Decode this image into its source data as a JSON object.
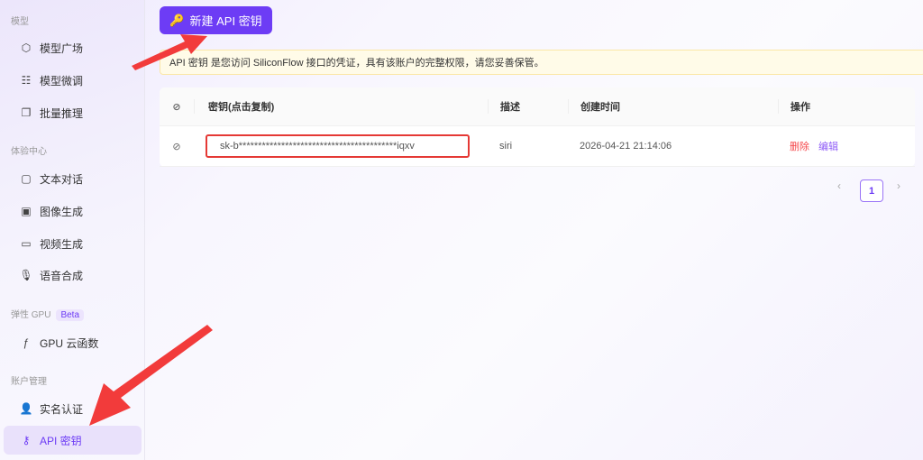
{
  "sidebar": {
    "sections": [
      "模型",
      "体验中心",
      "弹性 GPU",
      "账户管理"
    ],
    "beta": "Beta",
    "items": [
      {
        "label": "模型广场",
        "icon": "cube-icon"
      },
      {
        "label": "模型微调",
        "icon": "sliders-icon"
      },
      {
        "label": "批量推理",
        "icon": "layers-icon"
      },
      {
        "label": "文本对话",
        "icon": "chat-icon"
      },
      {
        "label": "图像生成",
        "icon": "image-icon"
      },
      {
        "label": "视频生成",
        "icon": "video-icon"
      },
      {
        "label": "语音合成",
        "icon": "mic-icon"
      },
      {
        "label": "GPU 云函数",
        "icon": "function-icon"
      },
      {
        "label": "实名认证",
        "icon": "user-check-icon"
      },
      {
        "label": "API 密钥",
        "icon": "key-icon"
      }
    ]
  },
  "main": {
    "new_button": "新建 API 密钥",
    "notice": "API 密钥 是您访问 SiliconFlow 接口的凭证，具有该账户的完整权限，请您妥善保管。",
    "table": {
      "headers": [
        "密钥(点击复制)",
        "描述",
        "创建时间",
        "操作"
      ],
      "rows": [
        {
          "key": "sk-b*****************************************iqxv",
          "desc": "siri",
          "created": "2026-04-21 21:14:06",
          "delete": "删除",
          "edit": "编辑"
        }
      ]
    },
    "pagination": {
      "current": "1"
    }
  },
  "colors": {
    "accent": "#6d3cf5",
    "danger": "#f5484b",
    "annotation": "#e53935"
  }
}
